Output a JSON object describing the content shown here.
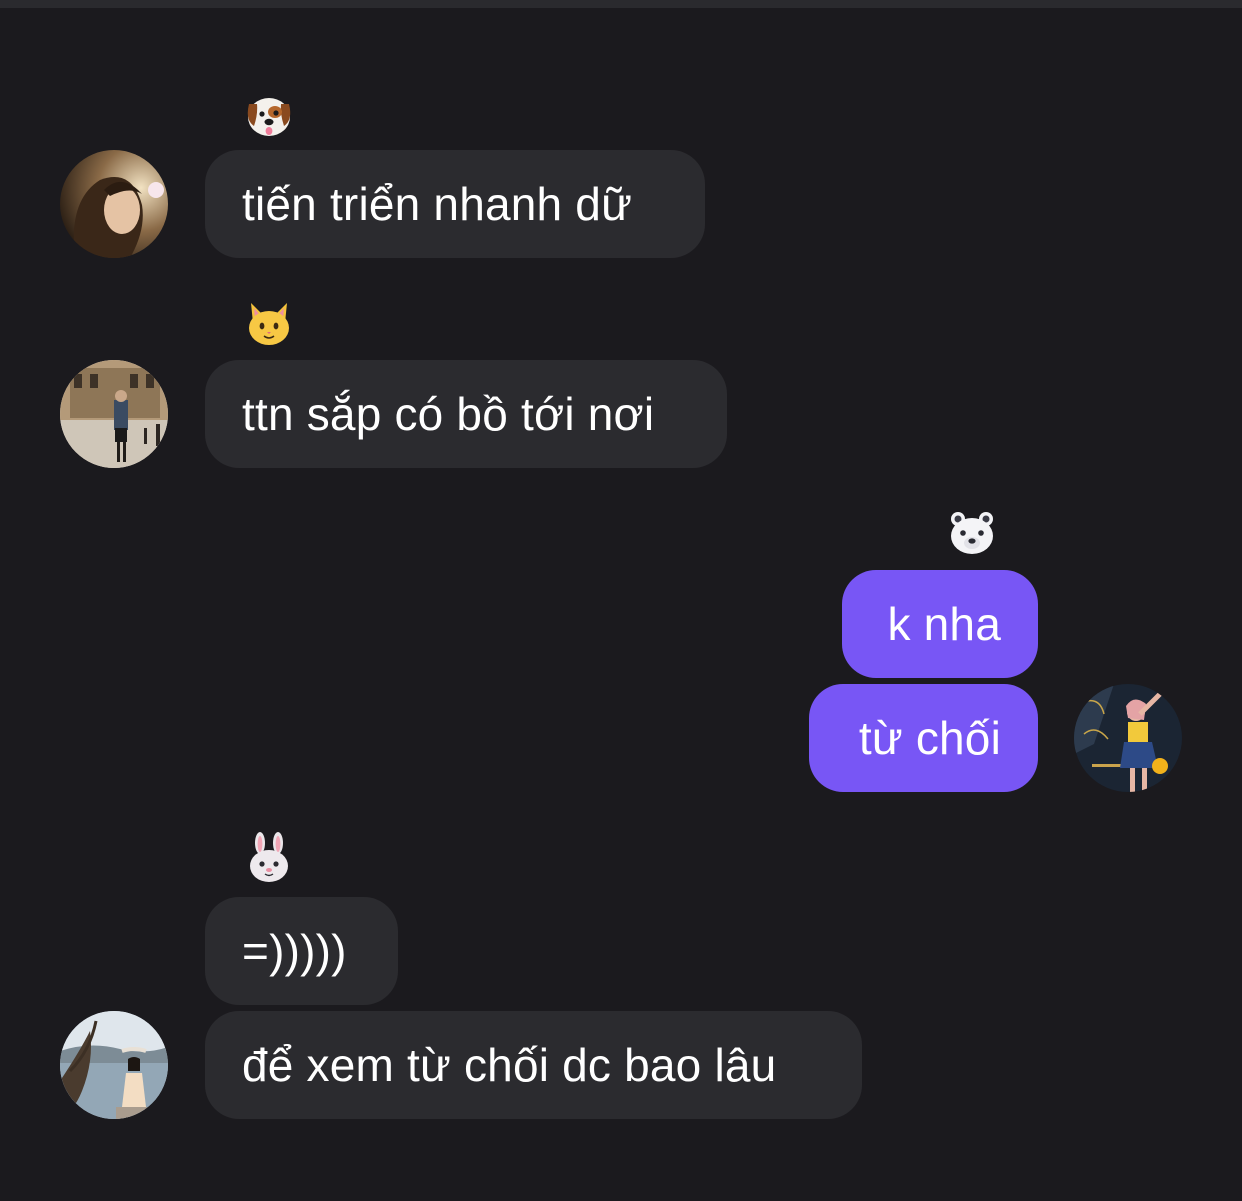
{
  "messages": [
    {
      "sender_emoji": "dog-face-icon",
      "text": "tiến triển nhanh dữ",
      "direction": "incoming"
    },
    {
      "sender_emoji": "cat-face-icon",
      "text": "ttn sắp có bồ tới nơi",
      "direction": "incoming"
    },
    {
      "sender_emoji": "polar-bear-face-icon",
      "text": "k nha",
      "direction": "outgoing"
    },
    {
      "text": "từ chối",
      "direction": "outgoing"
    },
    {
      "sender_emoji": "rabbit-face-icon",
      "text": "=)))))",
      "direction": "incoming"
    },
    {
      "text": "để xem từ chối dc bao lâu",
      "direction": "incoming"
    }
  ],
  "colors": {
    "background": "#1b1a1e",
    "incoming_bubble": "#2b2b2f",
    "outgoing_bubble": "#7856f5",
    "text": "#ffffff"
  }
}
